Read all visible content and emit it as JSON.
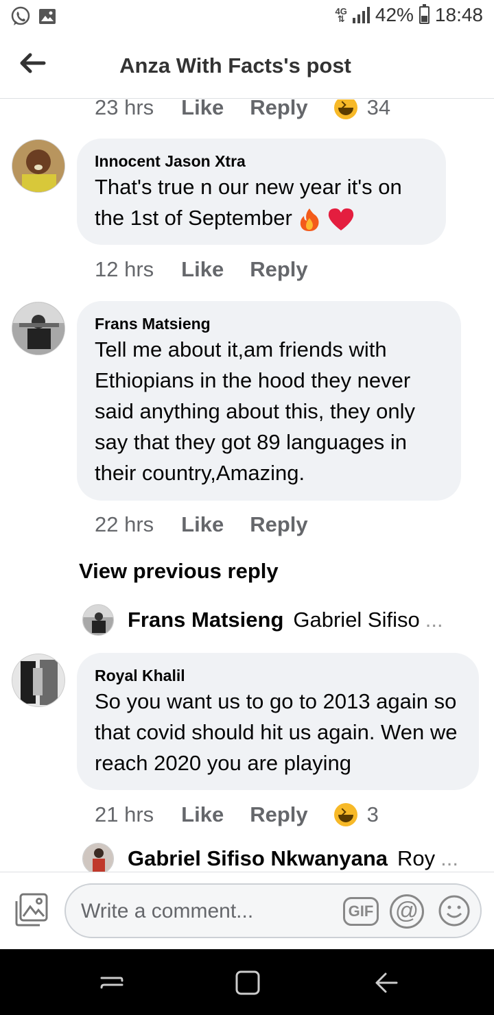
{
  "status_bar": {
    "network": "4G",
    "battery_percent": "42%",
    "battery_level": 0.42,
    "time": "18:48",
    "left_icons": [
      "whatsapp-icon",
      "gallery-icon"
    ]
  },
  "header": {
    "title": "Anza With Facts's post",
    "back_icon": "arrow-left-icon"
  },
  "top_actions": {
    "time": "23 hrs",
    "like": "Like",
    "reply": "Reply",
    "reaction_icon": "haha-icon",
    "reaction_count": "34"
  },
  "comments": [
    {
      "author": "Innocent Jason Xtra",
      "text": "That's true n our new year it's on the 1st  of September",
      "emojis": [
        "fire-icon",
        "heart-icon"
      ],
      "time": "12 hrs",
      "like": "Like",
      "reply": "Reply"
    },
    {
      "author": "Frans Matsieng",
      "text": "Tell me about it,am friends with Ethiopians in the hood they never said anything about this, they only say that they got 89 languages in their country,Amazing.",
      "time": "22 hrs",
      "like": "Like",
      "reply": "Reply",
      "view_previous": "View previous reply",
      "reply_preview": {
        "name": "Frans Matsieng",
        "snippet": "Gabriel Sifiso",
        "ellipsis": "..."
      }
    },
    {
      "author": "Royal Khalil",
      "text": "So you want us to go to 2013 again so that covid should  hit us again. Wen we reach 2020 you are playing",
      "time": "21 hrs",
      "like": "Like",
      "reply": "Reply",
      "reaction_icon": "haha-icon",
      "reaction_count": "3",
      "reply_preview": {
        "name": "Gabriel Sifiso Nkwanyana",
        "snippet": "Roy",
        "ellipsis": "..."
      }
    }
  ],
  "comment_bar": {
    "placeholder": "Write a comment...",
    "gif_label": "GIF",
    "at_label": "@"
  },
  "colors": {
    "bubble": "#f0f2f5",
    "meta_text": "#65676b",
    "haha": "#f7b928",
    "heart": "#e41e3f"
  }
}
